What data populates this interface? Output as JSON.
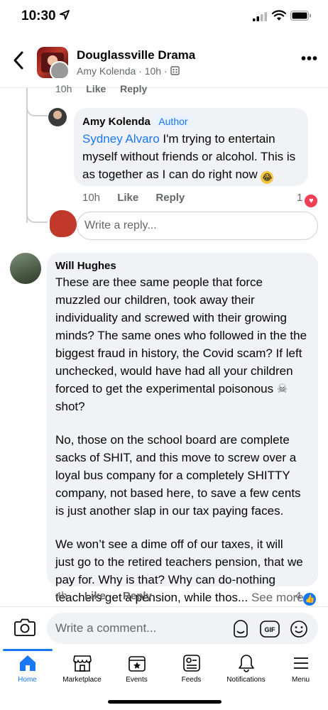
{
  "status_bar": {
    "time": "10:30"
  },
  "header": {
    "group_name": "Douglassville Drama",
    "poster": "Amy Kolenda",
    "age": "10h",
    "separator": "·"
  },
  "previous_meta": {
    "time": "10h",
    "like": "Like",
    "reply": "Reply"
  },
  "reply_comment": {
    "author": "Amy Kolenda",
    "badge": "Author",
    "mention": "Sydney Alvaro",
    "text_line1": " I'm trying to entertain",
    "text_line2": "myself without friends or alcohol. This is",
    "text_line3": "as together as I can do right now",
    "time": "10h",
    "like": "Like",
    "reply": "Reply",
    "reaction_count": "1"
  },
  "reply_input": {
    "placeholder": "Write a reply..."
  },
  "main_comment": {
    "author": "Will Hughes",
    "para1": [
      "These are thee same people that force",
      "muzzled our children, took away their",
      "individuality and screwed with their growing",
      "minds? The same ones who followed in the the",
      "biggest fraud in history, the Covid scam? If left",
      "unchecked, would have had all your children",
      "forced to get the experimental poisonous",
      "shot?"
    ],
    "para2": [
      "No, those on the school board are complete",
      "sacks of SHIT, and this move to screw over a",
      "loyal bus company for a completely SHITTY",
      "company, not based here, to save a few cents",
      "is just another slap in our tax paying faces."
    ],
    "para3": [
      "We won’t see a dime off of our taxes, it will",
      "just go to the retired teachers pension, that we",
      "pay for. Why is that? Why can do-nothing",
      "teachers get a pension, while thos..."
    ],
    "see_more": "See more",
    "time": "4h",
    "like": "Like",
    "reply": "Reply",
    "reaction_count": "4"
  },
  "composer": {
    "placeholder": "Write a comment..."
  },
  "tabs": [
    {
      "label": "Home",
      "icon": "home-icon"
    },
    {
      "label": "Marketplace",
      "icon": "marketplace-icon"
    },
    {
      "label": "Events",
      "icon": "events-icon"
    },
    {
      "label": "Feeds",
      "icon": "feeds-icon"
    },
    {
      "label": "Notifications",
      "icon": "bell-icon"
    },
    {
      "label": "Menu",
      "icon": "menu-icon"
    }
  ],
  "colors": {
    "accent": "#1877f2",
    "bubble": "#f0f2f5",
    "love": "#f33e58"
  }
}
